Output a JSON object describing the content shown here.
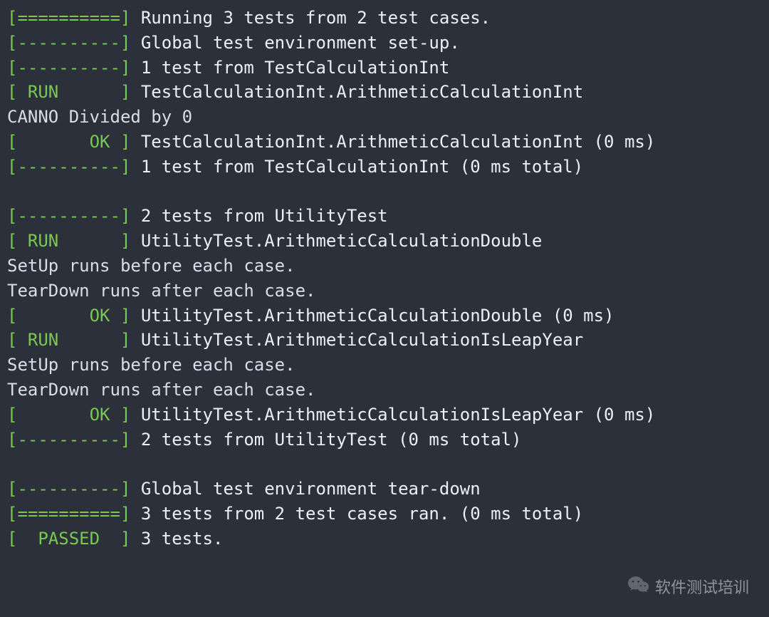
{
  "tags": {
    "bar_eq": "[==========]",
    "bar_dash": "[----------]",
    "run": "[ RUN      ]",
    "ok": "[       OK ]",
    "passed": "[  PASSED  ]"
  },
  "lines": [
    {
      "type": "tag",
      "tag": "bar_eq",
      "msg": "Running 3 tests from 2 test cases."
    },
    {
      "type": "tag",
      "tag": "bar_dash",
      "msg": "Global test environment set-up."
    },
    {
      "type": "tag",
      "tag": "bar_dash",
      "msg": "1 test from TestCalculationInt"
    },
    {
      "type": "tag",
      "tag": "run",
      "msg": "TestCalculationInt.ArithmeticCalculationInt"
    },
    {
      "type": "plain",
      "msg": "CANNO Divided by 0"
    },
    {
      "type": "tag",
      "tag": "ok",
      "msg": "TestCalculationInt.ArithmeticCalculationInt (0 ms)"
    },
    {
      "type": "tag",
      "tag": "bar_dash",
      "msg": "1 test from TestCalculationInt (0 ms total)"
    },
    {
      "type": "blank"
    },
    {
      "type": "tag",
      "tag": "bar_dash",
      "msg": "2 tests from UtilityTest"
    },
    {
      "type": "tag",
      "tag": "run",
      "msg": "UtilityTest.ArithmeticCalculationDouble"
    },
    {
      "type": "plain",
      "msg": "SetUp runs before each case."
    },
    {
      "type": "plain",
      "msg": "TearDown runs after each case."
    },
    {
      "type": "tag",
      "tag": "ok",
      "msg": "UtilityTest.ArithmeticCalculationDouble (0 ms)"
    },
    {
      "type": "tag",
      "tag": "run",
      "msg": "UtilityTest.ArithmeticCalculationIsLeapYear"
    },
    {
      "type": "plain",
      "msg": "SetUp runs before each case."
    },
    {
      "type": "plain",
      "msg": "TearDown runs after each case."
    },
    {
      "type": "tag",
      "tag": "ok",
      "msg": "UtilityTest.ArithmeticCalculationIsLeapYear (0 ms)"
    },
    {
      "type": "tag",
      "tag": "bar_dash",
      "msg": "2 tests from UtilityTest (0 ms total)"
    },
    {
      "type": "blank"
    },
    {
      "type": "tag",
      "tag": "bar_dash",
      "msg": "Global test environment tear-down"
    },
    {
      "type": "tag",
      "tag": "bar_eq",
      "msg": "3 tests from 2 test cases ran. (0 ms total)"
    },
    {
      "type": "tag",
      "tag": "passed",
      "msg": "3 tests."
    }
  ],
  "watermark": {
    "text": "软件测试培训",
    "icon": "wechat-icon"
  }
}
